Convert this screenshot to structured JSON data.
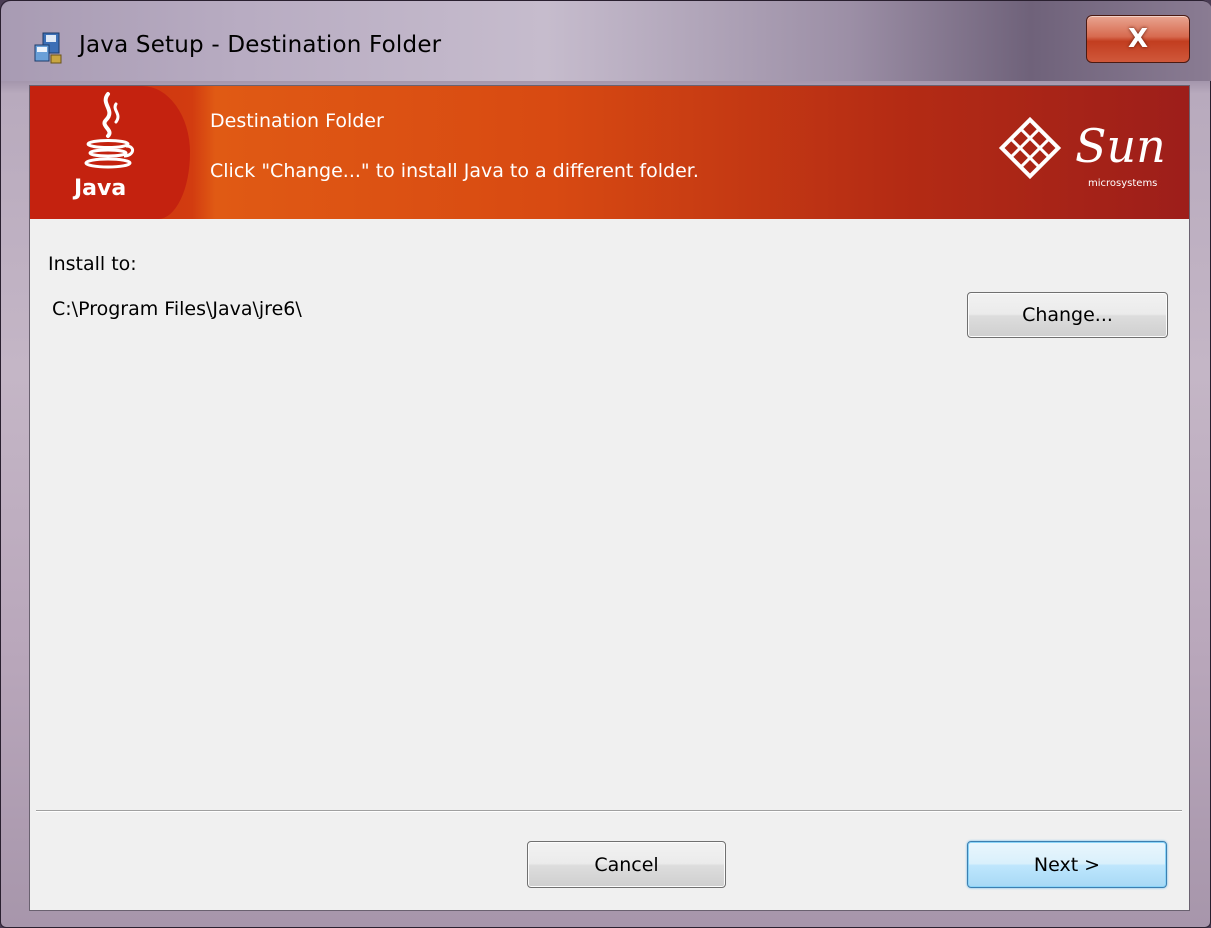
{
  "window": {
    "title": "Java Setup - Destination Folder",
    "close_label": "X"
  },
  "banner": {
    "title": "Destination Folder",
    "subtitle": "Click \"Change...\" to install Java to a different folder.",
    "java_logo_text": "Java",
    "sun_logo_text": "Sun",
    "sun_logo_subtext": "microsystems"
  },
  "content": {
    "install_label": "Install to:",
    "install_path": "C:\\Program Files\\Java\\jre6\\",
    "change_button": "Change..."
  },
  "footer": {
    "cancel_button": "Cancel",
    "next_button": "Next >"
  },
  "colors": {
    "banner_red": "#c72a12",
    "banner_orange": "#e05a14",
    "client_bg": "#f0f0f0",
    "next_button_accent": "#bee6fd"
  }
}
